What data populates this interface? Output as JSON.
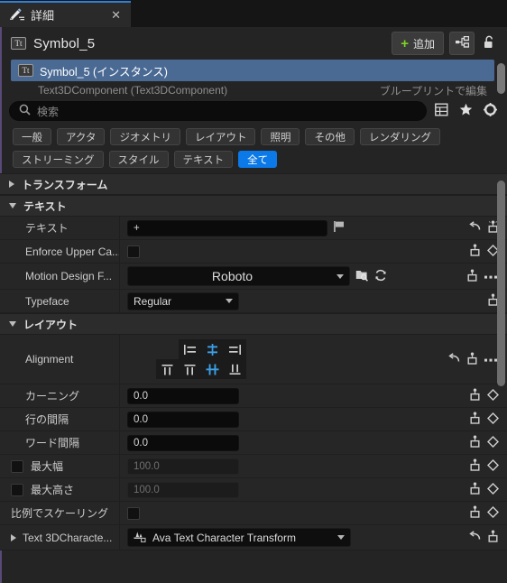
{
  "tab": {
    "title": "詳細",
    "icon": "details-brush-icon",
    "close_label": "✕",
    "accent_color": "#2f7fd4"
  },
  "header": {
    "title": "Symbol_5",
    "type_badge": "Tt",
    "add_button": "追加",
    "add_plus": "+",
    "blueprint_button_icon": "blueprint-hierarchy-icon",
    "lock_button_icon": "unlock-icon"
  },
  "selection": {
    "row_label": "Symbol_5 (インスタンス)",
    "row_badge": "Tt",
    "sub_label": "Text3DComponent (Text3DComponent)",
    "sub_right": "ブループリントで編集",
    "highlight_color": "#4a6a94"
  },
  "search": {
    "placeholder": "検索",
    "value": "",
    "icons": [
      "search-icon",
      "table-view-icon",
      "favorites-star-icon",
      "settings-gear-icon"
    ]
  },
  "filters": {
    "row1": [
      "一般",
      "アクタ",
      "ジオメトリ",
      "レイアウト",
      "照明",
      "その他",
      "レンダリング"
    ],
    "row2": [
      "ストリーミング",
      "スタイル",
      "テキスト",
      "全て"
    ],
    "active": "全て",
    "active_color": "#0b79e8"
  },
  "sections": {
    "transform": {
      "label": "トランスフォーム",
      "expanded": false
    },
    "text": {
      "label": "テキスト",
      "expanded": true
    },
    "layout": {
      "label": "レイアウト",
      "expanded": true
    }
  },
  "properties": {
    "text_value": {
      "label": "テキスト",
      "value": "+"
    },
    "enforce_upper": {
      "label": "Enforce Upper Ca...",
      "checked": false
    },
    "motion_design_font": {
      "label": "Motion Design F...",
      "value": "Roboto"
    },
    "typeface": {
      "label": "Typeface",
      "value": "Regular"
    },
    "alignment": {
      "label": "Alignment",
      "horizontal": [
        "align-left-icon",
        "align-center-icon",
        "align-right-icon"
      ],
      "horizontal_active": 1,
      "vertical": [
        "align-top-icon",
        "align-middle-top-icon",
        "align-center-v-icon",
        "align-bottom-icon"
      ],
      "vertical_active": 2
    },
    "kerning": {
      "label": "カーニング",
      "value": "0.0"
    },
    "line_spacing": {
      "label": "行の間隔",
      "value": "0.0"
    },
    "word_spacing": {
      "label": "ワード間隔",
      "value": "0.0"
    },
    "max_width": {
      "label": "最大幅",
      "value": "100.0",
      "checked": false,
      "disabled": true
    },
    "max_height": {
      "label": "最大高さ",
      "value": "100.0",
      "checked": false,
      "disabled": true
    },
    "scale_proportionally": {
      "label": "比例でスケーリング",
      "checked": false
    },
    "text_3d_character": {
      "label": "Text 3DCharacte...",
      "value": "Ava Text Character Transform"
    }
  },
  "row_icons": {
    "reset": "reset-arrow-icon",
    "keyframe": "keyframe-track-icon",
    "diamond": "keyframe-diamond-icon",
    "ellipsis": "more-options-icon",
    "flag": "flag-icon",
    "browse": "browse-asset-icon",
    "refresh": "refresh-icon"
  }
}
